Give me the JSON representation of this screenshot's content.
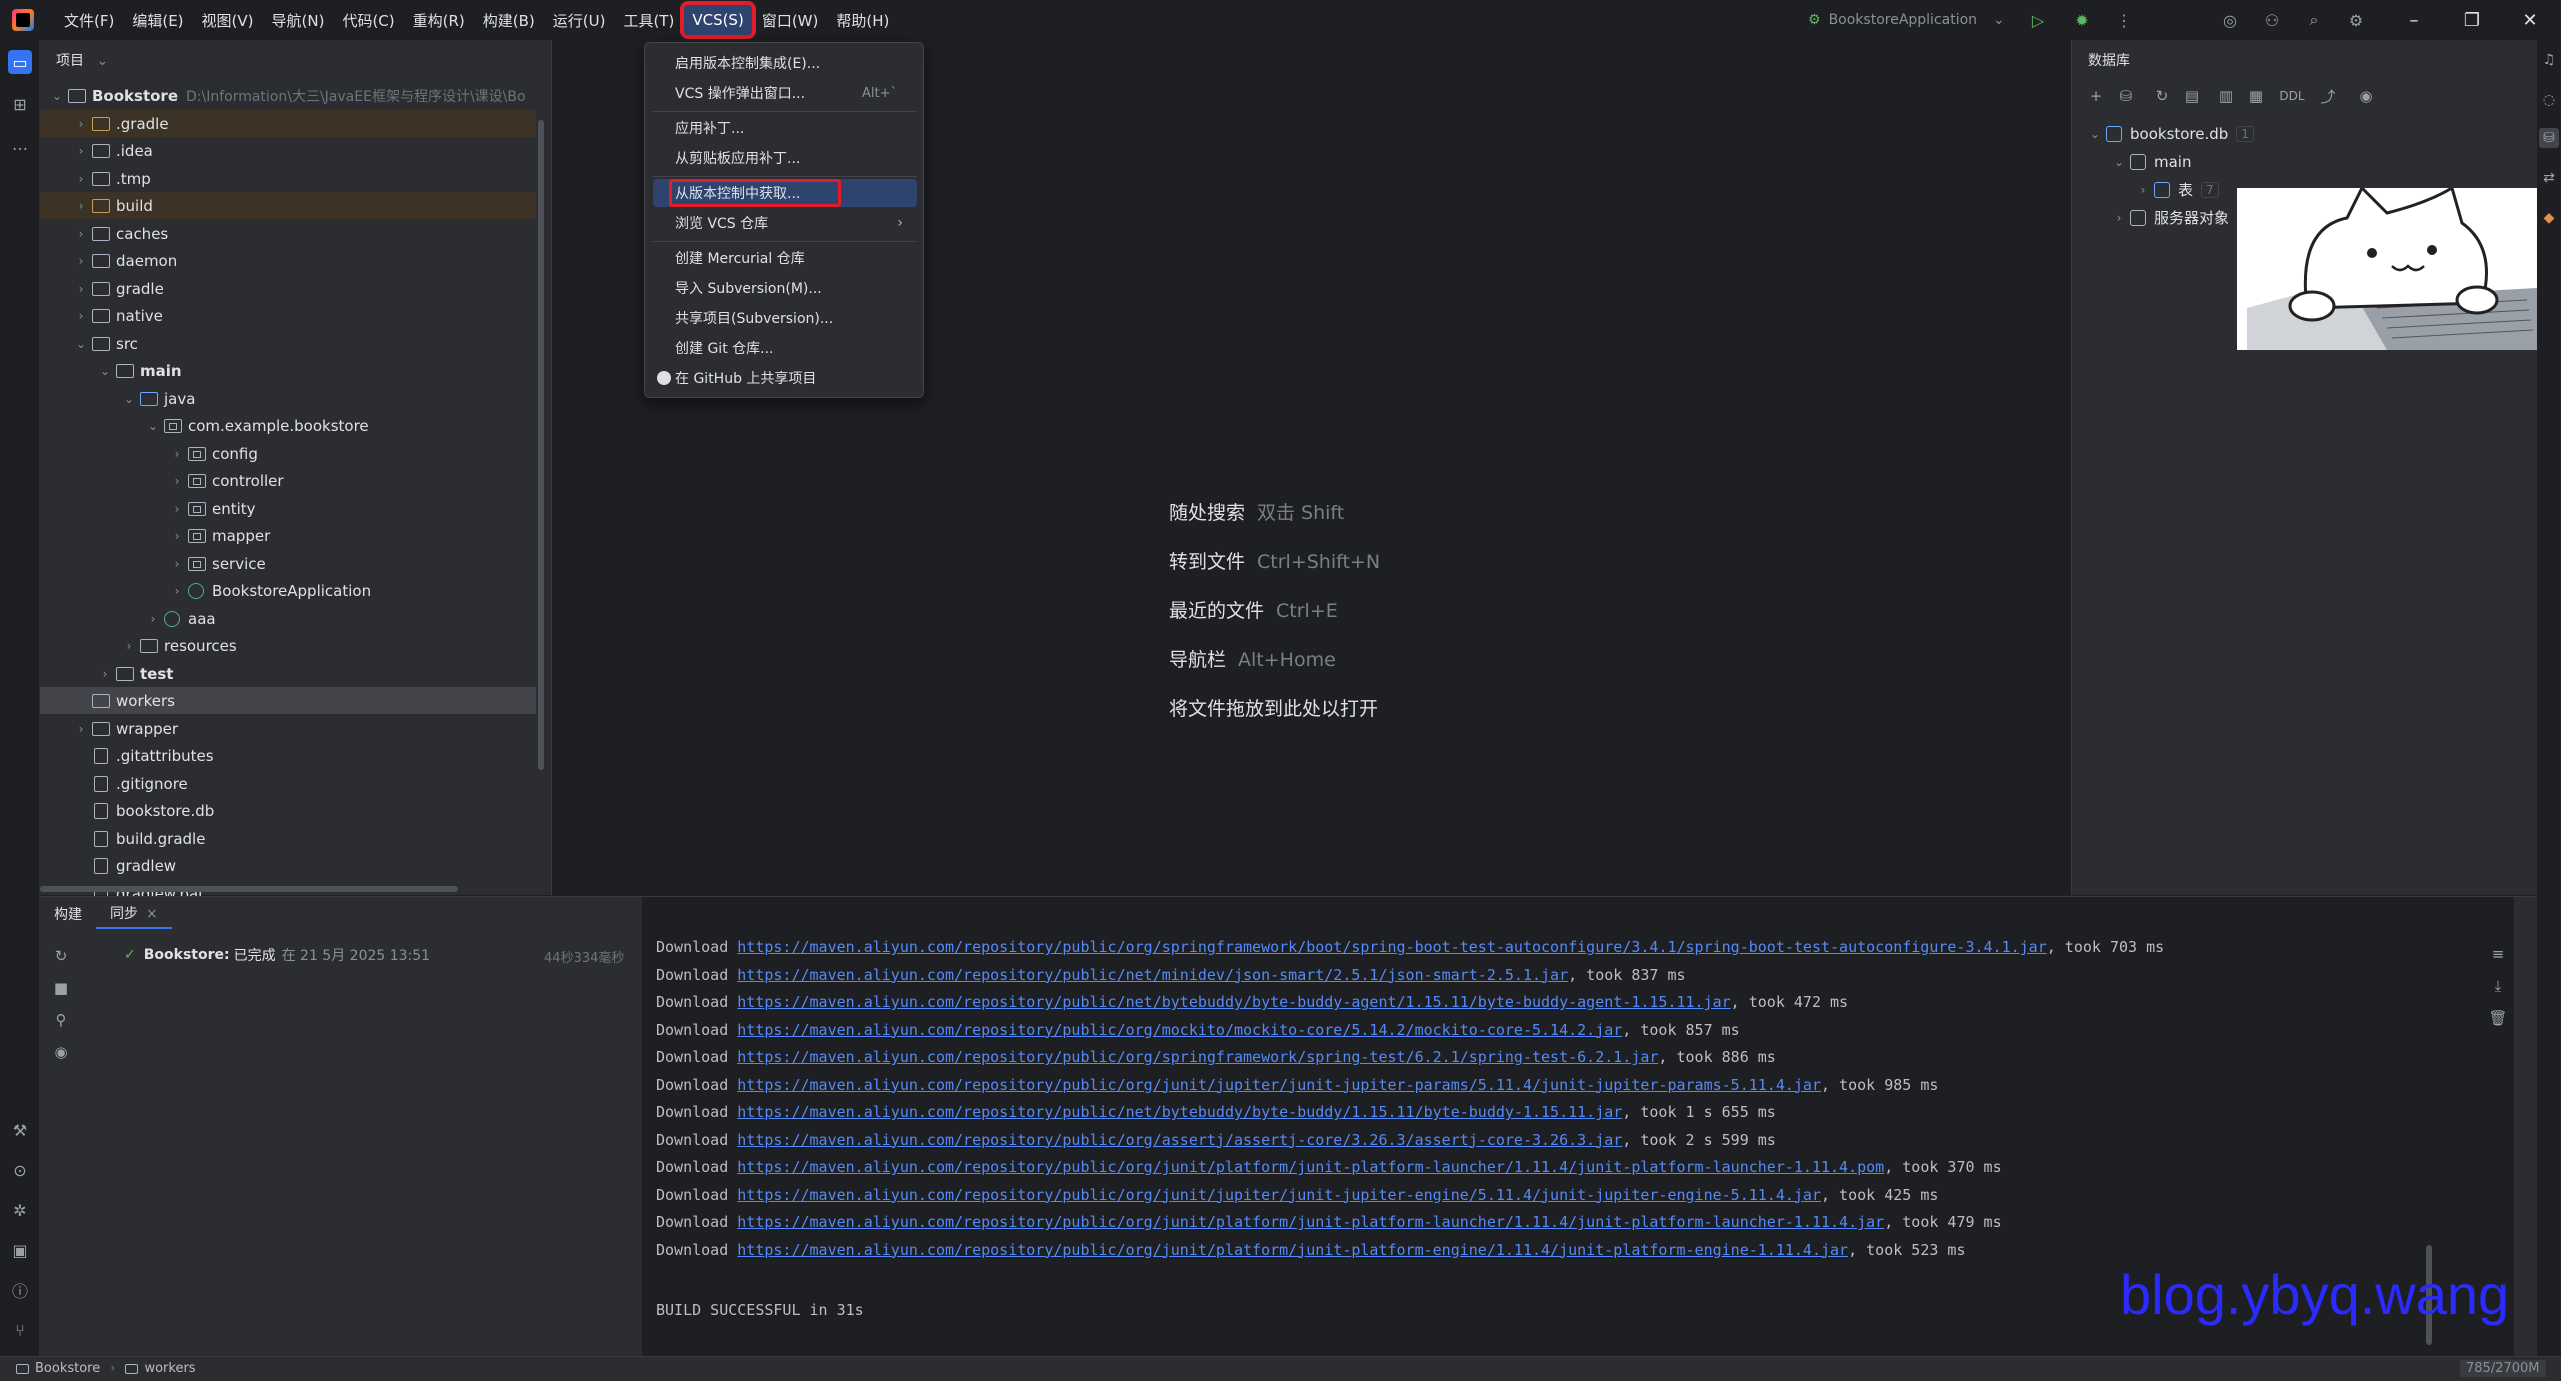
{
  "menubar": {
    "items": [
      "文件(F)",
      "编辑(E)",
      "视图(V)",
      "导航(N)",
      "代码(C)",
      "重构(R)",
      "构建(B)",
      "运行(U)",
      "工具(T)",
      "VCS(S)",
      "窗口(W)",
      "帮助(H)"
    ],
    "active_index": 9
  },
  "run_widget": {
    "config": "BookstoreApplication"
  },
  "project_panel": {
    "title": "项目",
    "tree": [
      {
        "label": "Bookstore",
        "hint": "D:\\Information\\大三\\JavaEE框架与程序设计\\课设\\Bo",
        "depth": 0,
        "expanded": true,
        "icon": "folder-module",
        "bold": true
      },
      {
        "label": ".gradle",
        "depth": 1,
        "expanded": false,
        "icon": "folder-excluded",
        "excluded": true
      },
      {
        "label": ".idea",
        "depth": 1,
        "expanded": false,
        "icon": "folder"
      },
      {
        "label": ".tmp",
        "depth": 1,
        "expanded": false,
        "icon": "folder"
      },
      {
        "label": "build",
        "depth": 1,
        "expanded": false,
        "icon": "folder-excluded",
        "excluded": true
      },
      {
        "label": "caches",
        "depth": 1,
        "expanded": false,
        "icon": "folder"
      },
      {
        "label": "daemon",
        "depth": 1,
        "expanded": false,
        "icon": "folder"
      },
      {
        "label": "gradle",
        "depth": 1,
        "expanded": false,
        "icon": "folder"
      },
      {
        "label": "native",
        "depth": 1,
        "expanded": false,
        "icon": "folder"
      },
      {
        "label": "src",
        "depth": 1,
        "expanded": true,
        "icon": "folder"
      },
      {
        "label": "main",
        "depth": 2,
        "expanded": true,
        "icon": "folder-module",
        "bold": true
      },
      {
        "label": "java",
        "depth": 3,
        "expanded": true,
        "icon": "folder-source"
      },
      {
        "label": "com.example.bookstore",
        "depth": 4,
        "expanded": true,
        "icon": "package"
      },
      {
        "label": "config",
        "depth": 5,
        "expanded": false,
        "icon": "package"
      },
      {
        "label": "controller",
        "depth": 5,
        "expanded": false,
        "icon": "package"
      },
      {
        "label": "entity",
        "depth": 5,
        "expanded": false,
        "icon": "package"
      },
      {
        "label": "mapper",
        "depth": 5,
        "expanded": false,
        "icon": "package"
      },
      {
        "label": "service",
        "depth": 5,
        "expanded": false,
        "icon": "package"
      },
      {
        "label": "BookstoreApplication",
        "depth": 5,
        "expanded": false,
        "icon": "spring-class"
      },
      {
        "label": "aaa",
        "depth": 4,
        "expanded": false,
        "icon": "spring-class"
      },
      {
        "label": "resources",
        "depth": 3,
        "expanded": false,
        "icon": "folder"
      },
      {
        "label": "test",
        "depth": 2,
        "expanded": false,
        "icon": "folder-module",
        "bold": true
      },
      {
        "label": "workers",
        "depth": 1,
        "expanded": null,
        "icon": "folder",
        "selected": true
      },
      {
        "label": "wrapper",
        "depth": 1,
        "expanded": false,
        "icon": "folder"
      },
      {
        "label": ".gitattributes",
        "depth": 1,
        "expanded": null,
        "icon": "file-lines"
      },
      {
        "label": ".gitignore",
        "depth": 1,
        "expanded": null,
        "icon": "file-ignore"
      },
      {
        "label": "bookstore.db",
        "depth": 1,
        "expanded": null,
        "icon": "file-db"
      },
      {
        "label": "build.gradle",
        "depth": 1,
        "expanded": null,
        "icon": "file-gradle"
      },
      {
        "label": "gradlew",
        "depth": 1,
        "expanded": null,
        "icon": "file"
      },
      {
        "label": "gradlew.bat",
        "depth": 1,
        "expanded": null,
        "icon": "file"
      }
    ]
  },
  "vcs_menu": {
    "items": [
      {
        "label": "启用版本控制集成(E)...",
        "shortcut": ""
      },
      {
        "label": "VCS 操作弹出窗口...",
        "shortcut": "Alt+`"
      },
      {
        "sep": true
      },
      {
        "label": "应用补丁...",
        "shortcut": ""
      },
      {
        "label": "从剪贴板应用补丁...",
        "shortcut": ""
      },
      {
        "sep": true
      },
      {
        "label": "从版本控制中获取...",
        "shortcut": "",
        "highlight": true
      },
      {
        "label": "浏览 VCS 仓库",
        "shortcut": "",
        "submenu": true
      },
      {
        "sep": true
      },
      {
        "label": "创建 Mercurial 仓库",
        "shortcut": ""
      },
      {
        "label": "导入 Subversion(M)...",
        "shortcut": ""
      },
      {
        "label": "共享项目(Subversion)...",
        "shortcut": ""
      },
      {
        "label": "创建 Git 仓库...",
        "shortcut": ""
      },
      {
        "label": "在 GitHub 上共享项目",
        "shortcut": "",
        "icon": "github-icon"
      }
    ]
  },
  "editor_hints": [
    {
      "label": "随处搜索",
      "key": "双击 Shift"
    },
    {
      "label": "转到文件",
      "key": "Ctrl+Shift+N"
    },
    {
      "label": "最近的文件",
      "key": "Ctrl+E"
    },
    {
      "label": "导航栏",
      "key": "Alt+Home"
    },
    {
      "label": "将文件拖放到此处以打开",
      "key": ""
    }
  ],
  "db_panel": {
    "title": "数据库",
    "ddl_label": "DDL",
    "tree": [
      {
        "label": "bookstore.db",
        "badge": "1",
        "depth": 0,
        "expanded": true
      },
      {
        "label": "main",
        "depth": 1,
        "expanded": true
      },
      {
        "label": "表",
        "badge": "7",
        "depth": 2,
        "expanded": false
      },
      {
        "label": "服务器对象",
        "depth": 1,
        "expanded": false
      }
    ]
  },
  "build_panel": {
    "tabs": [
      {
        "label": "构建"
      },
      {
        "label": "同步",
        "closable": true
      }
    ],
    "status_project": "Bookstore:",
    "status_text": "已完成",
    "status_when": "在 21 5月 2025 13:51",
    "duration": "44秒334毫秒",
    "log": [
      {
        "prefix": "Download ",
        "url": "https://maven.aliyun.com/repository/public/org/springframework/boot/spring-boot-test-autoconfigure/3.4.1/spring-boot-test-autoconfigure-3.4.1.jar",
        "suffix": ", took 703 ms"
      },
      {
        "prefix": "Download ",
        "url": "https://maven.aliyun.com/repository/public/net/minidev/json-smart/2.5.1/json-smart-2.5.1.jar",
        "suffix": ", took 837 ms"
      },
      {
        "prefix": "Download ",
        "url": "https://maven.aliyun.com/repository/public/net/bytebuddy/byte-buddy-agent/1.15.11/byte-buddy-agent-1.15.11.jar",
        "suffix": ", took 472 ms"
      },
      {
        "prefix": "Download ",
        "url": "https://maven.aliyun.com/repository/public/org/mockito/mockito-core/5.14.2/mockito-core-5.14.2.jar",
        "suffix": ", took 857 ms"
      },
      {
        "prefix": "Download ",
        "url": "https://maven.aliyun.com/repository/public/org/springframework/spring-test/6.2.1/spring-test-6.2.1.jar",
        "suffix": ", took 886 ms"
      },
      {
        "prefix": "Download ",
        "url": "https://maven.aliyun.com/repository/public/org/junit/jupiter/junit-jupiter-params/5.11.4/junit-jupiter-params-5.11.4.jar",
        "suffix": ", took 985 ms"
      },
      {
        "prefix": "Download ",
        "url": "https://maven.aliyun.com/repository/public/net/bytebuddy/byte-buddy/1.15.11/byte-buddy-1.15.11.jar",
        "suffix": ", took 1 s 655 ms"
      },
      {
        "prefix": "Download ",
        "url": "https://maven.aliyun.com/repository/public/org/assertj/assertj-core/3.26.3/assertj-core-3.26.3.jar",
        "suffix": ", took 2 s 599 ms"
      },
      {
        "prefix": "Download ",
        "url": "https://maven.aliyun.com/repository/public/org/junit/platform/junit-platform-launcher/1.11.4/junit-platform-launcher-1.11.4.pom",
        "suffix": ", took 370 ms"
      },
      {
        "prefix": "Download ",
        "url": "https://maven.aliyun.com/repository/public/org/junit/jupiter/junit-jupiter-engine/5.11.4/junit-jupiter-engine-5.11.4.jar",
        "suffix": ", took 425 ms"
      },
      {
        "prefix": "Download ",
        "url": "https://maven.aliyun.com/repository/public/org/junit/platform/junit-platform-launcher/1.11.4/junit-platform-launcher-1.11.4.jar",
        "suffix": ", took 479 ms"
      },
      {
        "prefix": "Download ",
        "url": "https://maven.aliyun.com/repository/public/org/junit/platform/junit-platform-engine/1.11.4/junit-platform-engine-1.11.4.jar",
        "suffix": ", took 523 ms"
      }
    ],
    "result": "BUILD SUCCESSFUL in 31s"
  },
  "watermark": "blog.ybyq.wang",
  "statusbar": {
    "breadcrumbs": [
      "Bookstore",
      "workers"
    ],
    "memory": "785/2700M"
  }
}
